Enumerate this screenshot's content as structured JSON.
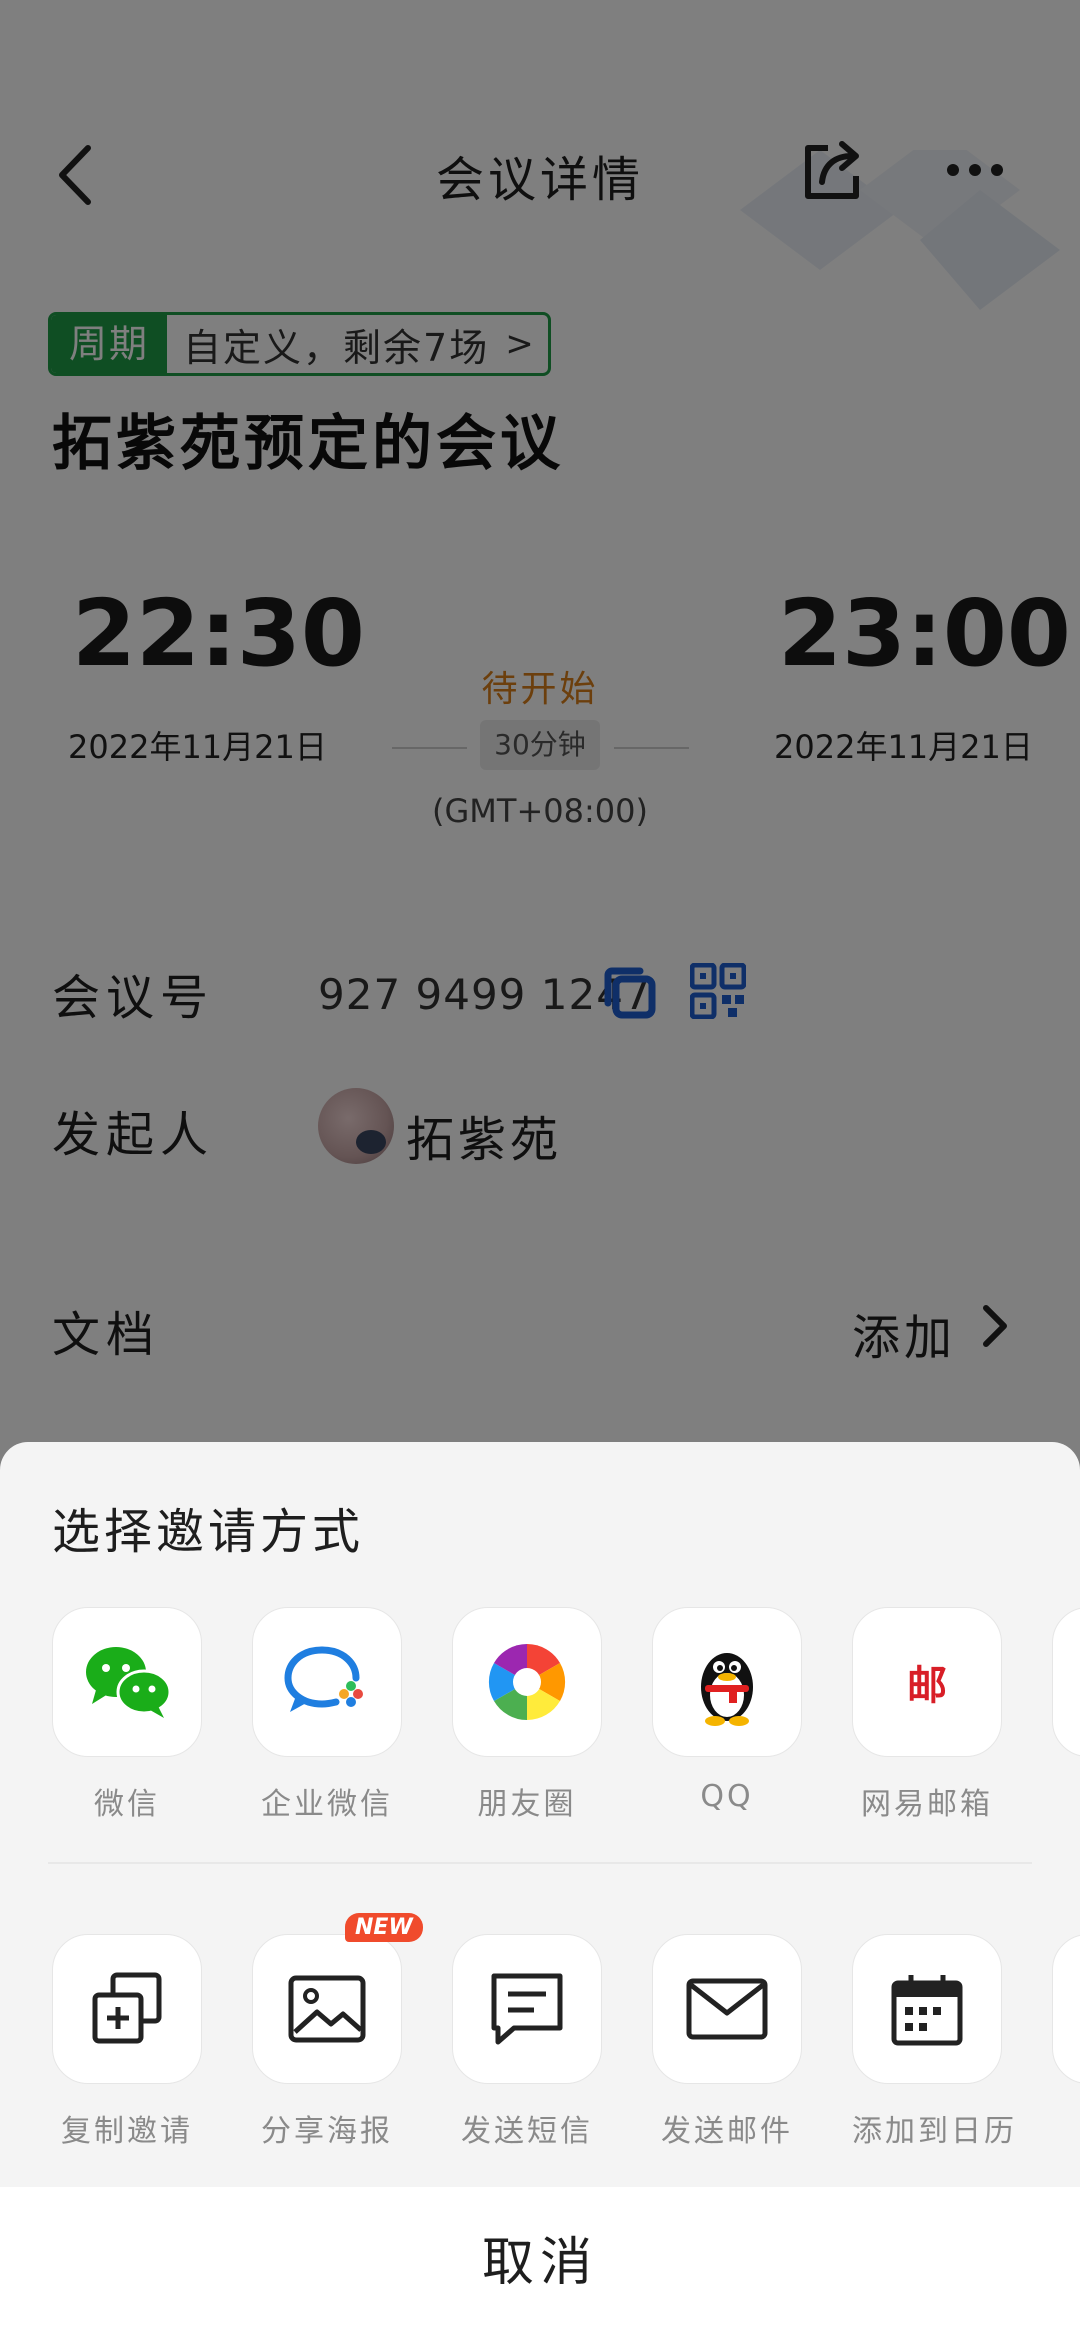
{
  "header": {
    "title": "会议详情"
  },
  "meeting": {
    "cycle_tag": "周期",
    "cycle_desc": "自定义，剩余7场",
    "title": "拓紫苑预定的会议",
    "start_time": "22:30",
    "start_date": "2022年11月21日",
    "status": "待开始",
    "duration": "30分钟",
    "timezone": "(GMT+08:00)",
    "end_time": "23:00",
    "end_date": "2022年11月21日"
  },
  "info": {
    "meeting_id_label": "会议号",
    "meeting_id": "927 9499 1247",
    "host_label": "发起人",
    "host_name": "拓紫苑",
    "docs_label": "文档",
    "docs_action": "添加"
  },
  "sheet": {
    "title": "选择邀请方式",
    "row1": [
      {
        "label": "微信",
        "icon": "wechat-icon"
      },
      {
        "label": "企业微信",
        "icon": "wecom-icon"
      },
      {
        "label": "朋友圈",
        "icon": "moments-icon"
      },
      {
        "label": "QQ",
        "icon": "qq-icon"
      },
      {
        "label": "网易邮箱",
        "icon": "netease-mail-icon"
      }
    ],
    "row2": [
      {
        "label": "复制邀请",
        "icon": "copy-invite-icon"
      },
      {
        "label": "分享海报",
        "icon": "poster-icon",
        "badge": "NEW"
      },
      {
        "label": "发送短信",
        "icon": "sms-icon"
      },
      {
        "label": "发送邮件",
        "icon": "email-icon"
      },
      {
        "label": "添加到日历",
        "icon": "calendar-icon"
      }
    ],
    "netease_glyph": "邮",
    "cancel": "取消"
  },
  "colors": {
    "green": "#1f9c46",
    "orange": "#d97f1a",
    "blue": "#1f5fd1",
    "red_badge": "#f04b2c"
  }
}
